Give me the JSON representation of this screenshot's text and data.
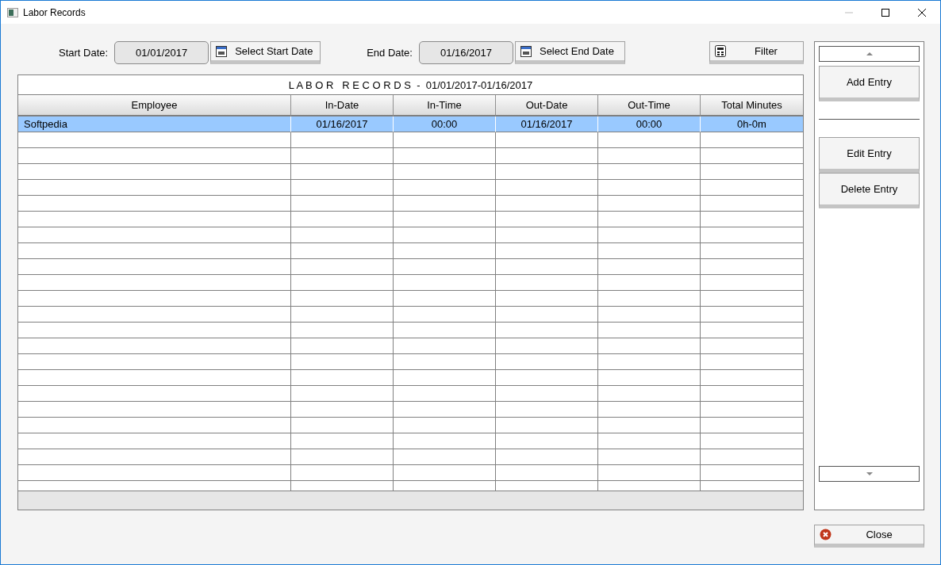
{
  "window": {
    "title": "Labor Records"
  },
  "filters": {
    "start_label": "Start Date:",
    "start_value": "01/01/2017",
    "start_button": "Select Start Date",
    "end_label": "End Date:",
    "end_value": "01/16/2017",
    "end_button": "Select End Date",
    "filter_button": "Filter"
  },
  "table": {
    "title": "L A B O R   R E C O R D S  -  01/01/2017-01/16/2017",
    "columns": [
      "Employee",
      "In-Date",
      "In-Time",
      "Out-Date",
      "Out-Time",
      "Total Minutes"
    ],
    "rows": [
      {
        "cells": [
          "Softpedia",
          "01/16/2017",
          "00:00",
          "01/16/2017",
          "00:00",
          "0h-0m"
        ],
        "selected": true
      }
    ]
  },
  "sidebar": {
    "buttons": [
      "Add Entry",
      "Edit Entry",
      "Delete Entry"
    ]
  },
  "close_button": "Close"
}
